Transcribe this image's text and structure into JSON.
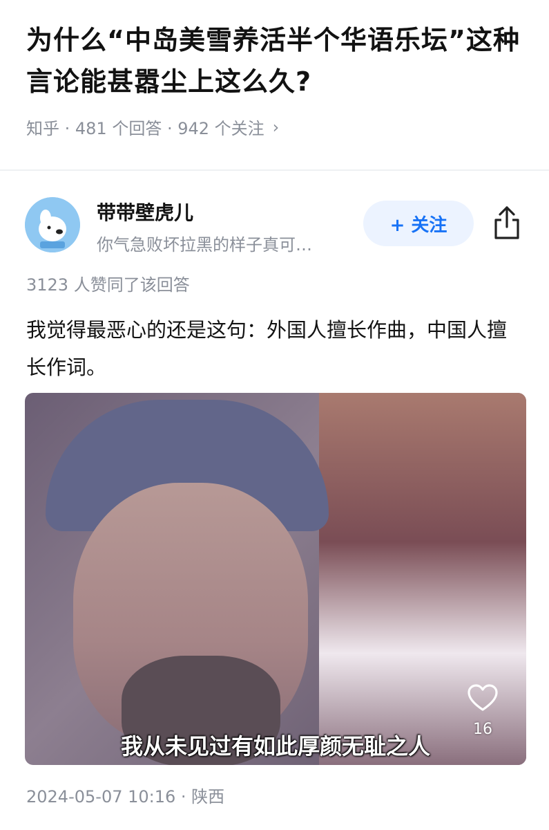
{
  "question": {
    "title": "为什么“中岛美雪养活半个华语乐坛”这种言论能甚嚣尘上这么久?",
    "meta": "知乎 · 481 个回答 · 942 个关注",
    "chevron": "›"
  },
  "author": {
    "name": "带带壁虎儿",
    "bio": "你气急败坏拉黑的样子真可…",
    "follow_label": "+ 关注",
    "accent_color": "#1772f6"
  },
  "answer": {
    "votes": "3123 人赞同了该回答",
    "content": "我觉得最恶心的还是这句：外国人擅长作曲，中国人擅长作词。",
    "image_caption": "我从未见过有如此厚颜无耻之人",
    "like_count": "16",
    "footer": "2024-05-07 10:16 · 陕西"
  },
  "icons": {
    "share": "share-icon",
    "heart": "heart-icon",
    "chevron": "chevron-right-icon",
    "avatar": "avatar-icon"
  }
}
